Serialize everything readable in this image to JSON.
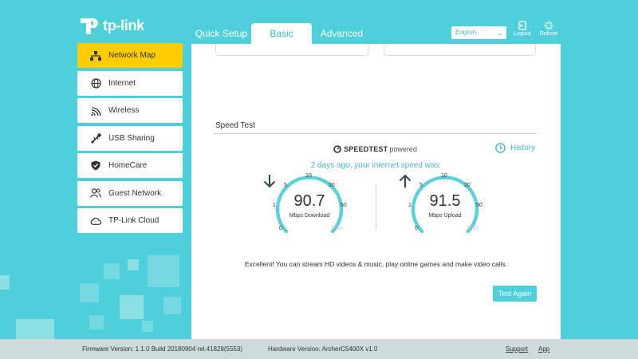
{
  "brand": {
    "logo_text": "tp-link"
  },
  "tabs": [
    {
      "label": "Quick Setup"
    },
    {
      "label": "Basic"
    },
    {
      "label": "Advanced"
    }
  ],
  "header": {
    "language": "English",
    "logout_label": "Logout",
    "reboot_label": "Reboot"
  },
  "sidebar": {
    "items": [
      {
        "label": "Network Map",
        "icon": "network-map-icon",
        "active": true
      },
      {
        "label": "Internet",
        "icon": "globe-icon"
      },
      {
        "label": "Wireless",
        "icon": "wifi-icon"
      },
      {
        "label": "USB Sharing",
        "icon": "usb-icon"
      },
      {
        "label": "HomeCare",
        "icon": "shield-icon"
      },
      {
        "label": "Guest Network",
        "icon": "guests-icon"
      },
      {
        "label": "TP-Link Cloud",
        "icon": "cloud-icon"
      }
    ]
  },
  "speed_test": {
    "section_title": "Speed Test",
    "brand_bold": "SPEEDTEST",
    "brand_suffix": "powered",
    "history_label": "History",
    "summary": "2 days ago, your internet speed was:",
    "scale_labels": [
      "0",
      "1",
      "5",
      "10",
      "20",
      "50",
      "100+"
    ],
    "download": {
      "value": "90.7",
      "unit": "Mbps Download"
    },
    "upload": {
      "value": "91.5",
      "unit": "Mbps Upload"
    },
    "message": "Excellent! You can stream HD videos & music, play online games and make video calls.",
    "test_again_label": "Test Again"
  },
  "footer": {
    "firmware": "Firmware Version: 1.1.0 Build 20180904 rel.41828(5553)",
    "hardware": "Hardware Version: ArcherC5400X v1.0",
    "support_label": "Support",
    "app_label": "App"
  },
  "colors": {
    "background": "#4ecfd9",
    "accent": "#4ab4c4",
    "active_menu": "#ffcc00",
    "footer": "#cfdadd"
  }
}
